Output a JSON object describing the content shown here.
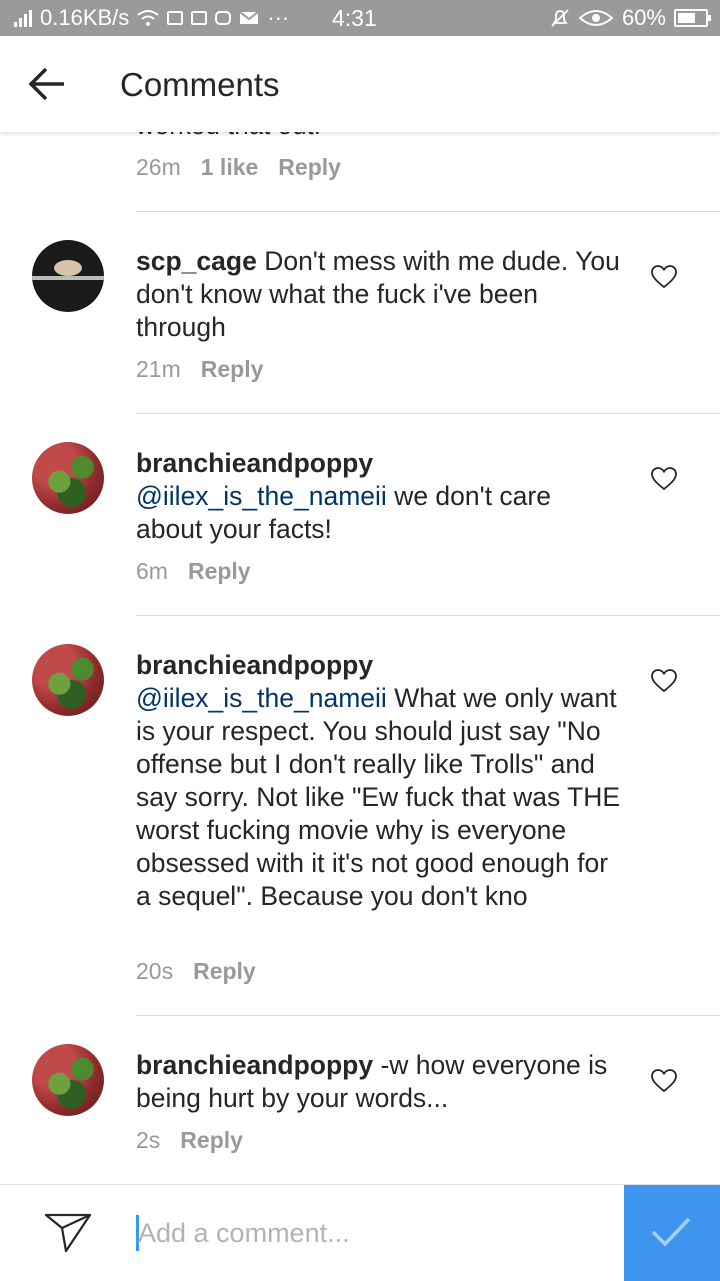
{
  "status_bar": {
    "speed": "0.16KB/s",
    "time": "4:31",
    "battery": "60%",
    "icons": [
      "signal-icon",
      "wifi-icon",
      "app-icon",
      "mail-icon",
      "instagram-icon",
      "email-icon",
      "more-icon",
      "bell-off-icon",
      "eye-icon",
      "battery-icon"
    ]
  },
  "header": {
    "title": "Comments"
  },
  "top_comment": {
    "partial_text": "worked that out!",
    "time": "26m",
    "likes": "1 like",
    "reply": "Reply"
  },
  "comments": [
    {
      "username": "scp_cage",
      "text": "Don't mess with me dude. You don't know what the fuck i've been through",
      "time": "21m",
      "reply": "Reply"
    },
    {
      "username": "branchieandpoppy",
      "mention": "@iilex_is_the_nameii",
      "text": "we don't care about your facts!",
      "time": "6m",
      "reply": "Reply"
    },
    {
      "username": "branchieandpoppy",
      "mention": "@iilex_is_the_nameii",
      "text": "What we only want is your respect. You should just say \"No offense but I don't really like Trolls\" and say sorry. Not like \"Ew fuck that was THE worst fucking movie why is everyone obsessed with it it's not good enough for a sequel\". Because you don't kno",
      "time": "20s",
      "reply": "Reply"
    },
    {
      "username": "branchieandpoppy",
      "text": "-w how everyone is being hurt by your words...",
      "time": "2s",
      "reply": "Reply"
    }
  ],
  "composer": {
    "placeholder": "Add a comment..."
  },
  "colors": {
    "accent": "#3d95f0",
    "mention": "#003569",
    "meta": "#999999",
    "statusbar": "#9a9a9a"
  }
}
